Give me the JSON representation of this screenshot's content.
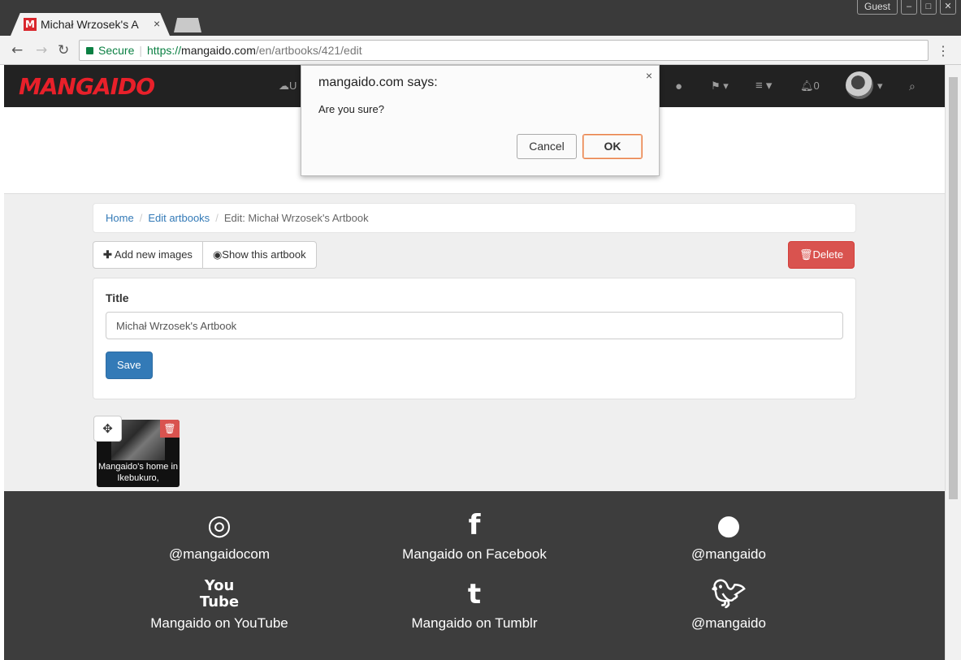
{
  "browser": {
    "tab_title": "Michał Wrzosek's A",
    "tab_close": "×",
    "favicon_letter": "M",
    "guest_label": "Guest",
    "address": {
      "secure_label": "Secure",
      "scheme": "https://",
      "domain": "mangaido.com",
      "path": "/en/artbooks/421/edit"
    }
  },
  "navbar": {
    "logo": "MANGAIDO",
    "upload_label": "U",
    "notifications_count": "0"
  },
  "breadcrumb": {
    "home": "Home",
    "edit_artbooks": "Edit artbooks",
    "current": "Edit: Michał Wrzosek's Artbook",
    "separator": "/"
  },
  "actions": {
    "add_images": "Add new images",
    "show_artbook": "Show this artbook",
    "delete": "Delete"
  },
  "form": {
    "title_label": "Title",
    "title_value": "Michał Wrzosek's Artbook",
    "save": "Save"
  },
  "image_card": {
    "caption": "Mangaido's home in Ikebukuro,"
  },
  "footer": {
    "instagram": "@mangaidocom",
    "facebook": "Mangaido on Facebook",
    "snapchat": "@mangaido",
    "youtube": "Mangaido on YouTube",
    "tumblr": "Mangaido on Tumblr",
    "twitter": "@mangaido"
  },
  "dialog": {
    "title": "mangaido.com says:",
    "message": "Are you sure?",
    "cancel": "Cancel",
    "ok": "OK",
    "close": "×"
  },
  "colors": {
    "brand": "#e8202a",
    "primary": "#337ab7",
    "danger": "#d9534f",
    "footer_bg": "#3d3d3d"
  }
}
